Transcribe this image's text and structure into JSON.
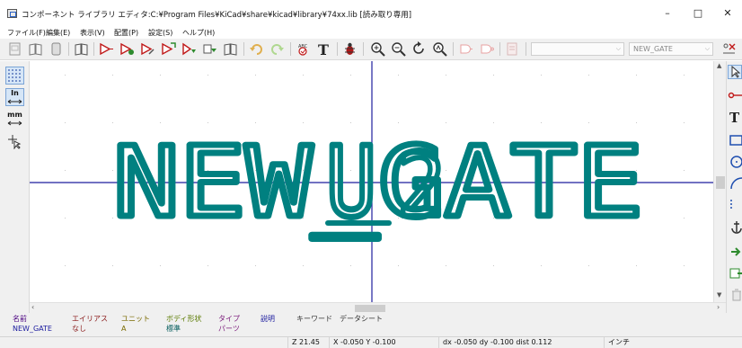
{
  "window": {
    "title": "コンポーネント ライブラリ エディタ:C:¥Program Files¥KiCad¥share¥kicad¥library¥74xx.lib [読み取り専用]",
    "minimize": "–",
    "maximize": "□",
    "close": "✕"
  },
  "menu": {
    "items": [
      "ファイル(F)",
      "編集(E)",
      "表示(V)",
      "配置(P)",
      "設定(S)",
      "ヘルプ(H)"
    ]
  },
  "toolbar": {
    "unit_combo_value": "",
    "component_combo_value": "NEW_GATE",
    "text_tool_glyph": "T",
    "spell_label": "ABC"
  },
  "lefttool": {
    "inch_label": "In",
    "mm_label": "mm"
  },
  "righttool": {
    "text_glyph": "T"
  },
  "canvas": {
    "reference_text": "U",
    "value_text": "NEW_GATE",
    "unit_text": "2",
    "colors": {
      "text": "#008080",
      "axis": "#1f1f9e",
      "grid": "#c8c8c8"
    }
  },
  "message_panel": {
    "fields": [
      {
        "label": "名前",
        "value": "NEW_GATE",
        "label_color": "#4a0080",
        "value_color": "#1a1a9e"
      },
      {
        "label": "エイリアス",
        "value": "なし",
        "label_color": "#8a1a1a",
        "value_color": "#8a1a1a"
      },
      {
        "label": "ユニット",
        "value": "A",
        "label_color": "#7a6a00",
        "value_color": "#7a6a00"
      },
      {
        "label": "ボディ形状",
        "value": "標準",
        "label_color": "#5a7a00",
        "value_color": "#005a5a"
      },
      {
        "label": "タイプ",
        "value": "パーツ",
        "label_color": "#7a1a7a",
        "value_color": "#7a1a7a"
      },
      {
        "label": "説明",
        "value": "",
        "label_color": "#1a1a9e",
        "value_color": "#1a1a9e"
      },
      {
        "label": "キーワード",
        "value": "",
        "label_color": "#333333",
        "value_color": "#333333"
      },
      {
        "label": "データシート",
        "value": "",
        "label_color": "#333333",
        "value_color": "#333333"
      }
    ]
  },
  "status": {
    "zoom": "Z 21.45",
    "cursor": "X -0.050  Y -0.100",
    "delta": "dx -0.050  dy -0.100  dist 0.112",
    "units": "インチ"
  }
}
